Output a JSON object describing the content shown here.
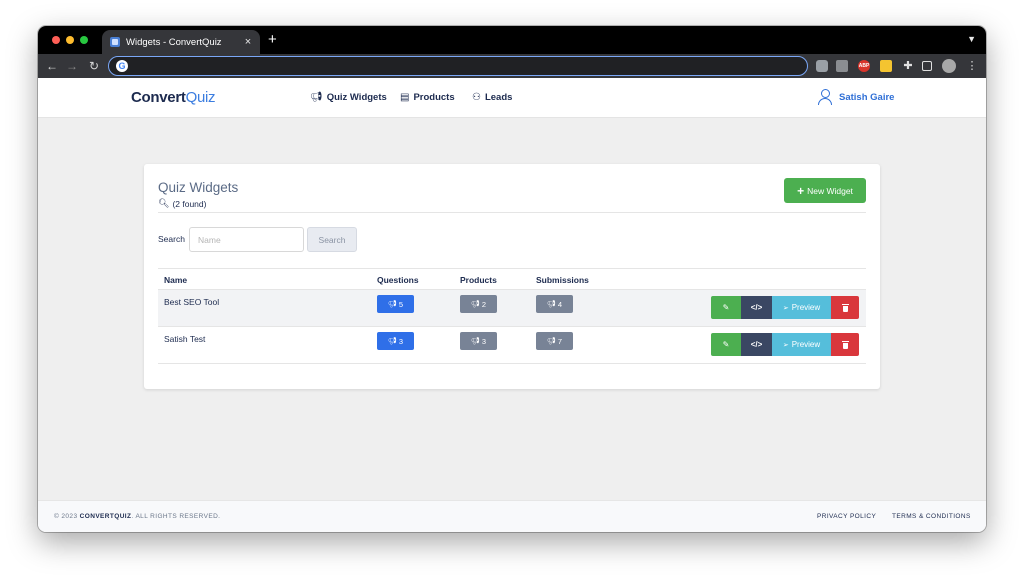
{
  "browser": {
    "tab_title": "Widgets - ConvertQuiz",
    "tab_close": "×",
    "new_tab": "+",
    "address": ""
  },
  "navbar": {
    "brand_part1": "Convert",
    "brand_part2": "Quiz",
    "links": [
      {
        "label": "Quiz Widgets",
        "icon": "megaphone-icon"
      },
      {
        "label": "Products",
        "icon": "table-icon"
      },
      {
        "label": "Leads",
        "icon": "users-icon"
      }
    ],
    "user_name": "Satish Gaire"
  },
  "widgets": {
    "title": "Quiz Widgets",
    "found": "(2 found)",
    "new_button": "New Widget",
    "search_label": "Search",
    "search_placeholder": "Name",
    "search_button": "Search",
    "columns": [
      "Name",
      "Questions",
      "Products",
      "Submissions"
    ],
    "rows": [
      {
        "name": "Best SEO Tool",
        "questions": "5",
        "products": "2",
        "submissions": "4"
      },
      {
        "name": "Satish Test",
        "questions": "3",
        "products": "3",
        "submissions": "7"
      }
    ],
    "action_preview": "Preview",
    "action_code": "</>"
  },
  "footer": {
    "copyright_prefix": "© 2023 ",
    "copyright_brand": "CONVERTQUIZ",
    "copyright_suffix": ". ALL RIGHTS RESERVED.",
    "privacy": "PRIVACY POLICY",
    "terms": "TERMS & CONDITIONS"
  },
  "colors": {
    "accent": "#3b7de0",
    "success": "#4caf50",
    "danger": "#d9373c",
    "info": "#55bedb",
    "dark": "#3a4763",
    "muted": "#788396"
  }
}
